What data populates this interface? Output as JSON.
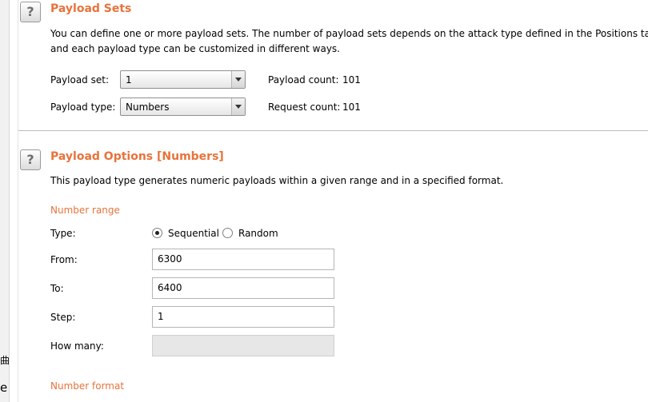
{
  "gutter": {
    "glyph1": "曲",
    "glyph2": "e"
  },
  "payload_sets": {
    "help_glyph": "?",
    "title": "Payload Sets",
    "description_line1": "You can define one or more payload sets. The number of payload sets depends on the attack type defined in the Positions tab. Va",
    "description_line2": "and each payload type can be customized in different ways.",
    "payload_set_label": "Payload set:",
    "payload_set_value": "1",
    "payload_type_label": "Payload type:",
    "payload_type_value": "Numbers",
    "payload_count_label": "Payload count:",
    "payload_count_value": "101",
    "request_count_label": "Request count:",
    "request_count_value": "101"
  },
  "payload_options": {
    "help_glyph": "?",
    "title": "Payload Options [Numbers]",
    "description": "This payload type generates numeric payloads within a given range and in a specified format.",
    "number_range_title": "Number range",
    "type_label": "Type:",
    "sequential_label": "Sequential",
    "random_label": "Random",
    "selected_type": "Sequential",
    "from_label": "From:",
    "from_value": "6300",
    "to_label": "To:",
    "to_value": "6400",
    "step_label": "Step:",
    "step_value": "1",
    "how_many_label": "How many:",
    "how_many_value": "",
    "number_format_title": "Number format"
  }
}
